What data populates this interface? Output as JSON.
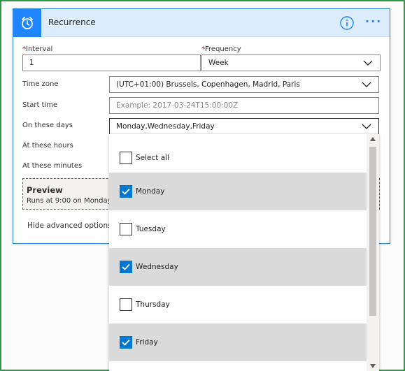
{
  "header": {
    "title": "Recurrence",
    "icon": "alarm-clock-icon"
  },
  "interval": {
    "label": "Interval",
    "required_mark": "*",
    "value": "1"
  },
  "frequency": {
    "label": "Frequency",
    "required_mark": "*",
    "value": "Week"
  },
  "time_zone": {
    "label": "Time zone",
    "value": "(UTC+01:00) Brussels, Copenhagen, Madrid, Paris"
  },
  "start_time": {
    "label": "Start time",
    "placeholder": "Example: 2017-03-24T15:00:00Z"
  },
  "on_these_days": {
    "label": "On these days",
    "value": "Monday,Wednesday,Friday"
  },
  "at_these_hours": {
    "label": "At these hours"
  },
  "at_these_minutes": {
    "label": "At these minutes"
  },
  "preview": {
    "title": "Preview",
    "text": "Runs at 9:00 on Monday,"
  },
  "hide_advanced": "Hide advanced options",
  "day_options": [
    {
      "label": "Select all",
      "checked": false
    },
    {
      "label": "Monday",
      "checked": true
    },
    {
      "label": "Tuesday",
      "checked": false
    },
    {
      "label": "Wednesday",
      "checked": true
    },
    {
      "label": "Thursday",
      "checked": false
    },
    {
      "label": "Friday",
      "checked": true
    }
  ],
  "colors": {
    "accent": "#0078d4",
    "header_bg": "#dcecfc",
    "frame": "#2e9a45"
  }
}
